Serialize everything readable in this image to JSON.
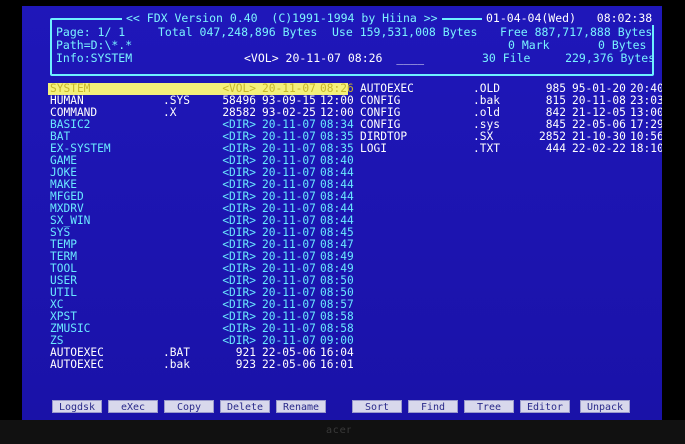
{
  "header": {
    "title": "<< FDX Version 0.40  (C)1991-1994 by Hiina >>",
    "datetime": "01-04-04(Wed)   08:02:38",
    "line1_left": "Page: 1/ 1",
    "line1_total": "Total 047,248,896 Bytes",
    "line1_use": "Use 159,531,008 Bytes",
    "line1_free": "Free 887,717,888 Bytes",
    "line2_left": "Path=D:\\*.*",
    "line2_mark": "0 Mark       0 Bytes",
    "line3_left": "Info:SYSTEM",
    "line3_vol": "<VOL> 20-11-07 08:26  ____",
    "line3_file": "30 File     229,376 Bytes"
  },
  "left_files": [
    {
      "name": "SYSTEM",
      "ext": "",
      "size": "<VOL>",
      "date": "20-11-07",
      "time": "08:26",
      "type": "sel"
    },
    {
      "name": "HUMAN",
      "ext": ".SYS",
      "size": "58496",
      "date": "93-09-15",
      "time": "12:00",
      "type": "file"
    },
    {
      "name": "COMMAND",
      "ext": ".X",
      "size": "28582",
      "date": "93-02-25",
      "time": "12:00",
      "type": "file"
    },
    {
      "name": "BASIC2",
      "ext": "",
      "size": "<DIR>",
      "date": "20-11-07",
      "time": "08:34",
      "type": "dir"
    },
    {
      "name": "BAT",
      "ext": "",
      "size": "<DIR>",
      "date": "20-11-07",
      "time": "08:35",
      "type": "dir"
    },
    {
      "name": "EX-SYSTEM",
      "ext": "",
      "size": "<DIR>",
      "date": "20-11-07",
      "time": "08:35",
      "type": "dir"
    },
    {
      "name": "GAME",
      "ext": "",
      "size": "<DIR>",
      "date": "20-11-07",
      "time": "08:40",
      "type": "dir"
    },
    {
      "name": "JOKE",
      "ext": "",
      "size": "<DIR>",
      "date": "20-11-07",
      "time": "08:44",
      "type": "dir"
    },
    {
      "name": "MAKE",
      "ext": "",
      "size": "<DIR>",
      "date": "20-11-07",
      "time": "08:44",
      "type": "dir"
    },
    {
      "name": "MFGED",
      "ext": "",
      "size": "<DIR>",
      "date": "20-11-07",
      "time": "08:44",
      "type": "dir"
    },
    {
      "name": "MXDRV",
      "ext": "",
      "size": "<DIR>",
      "date": "20-11-07",
      "time": "08:44",
      "type": "dir"
    },
    {
      "name": "SX_WIN",
      "ext": "",
      "size": "<DIR>",
      "date": "20-11-07",
      "time": "08:44",
      "type": "dir"
    },
    {
      "name": "SYS",
      "ext": "",
      "size": "<DIR>",
      "date": "20-11-07",
      "time": "08:45",
      "type": "dir"
    },
    {
      "name": "TEMP",
      "ext": "",
      "size": "<DIR>",
      "date": "20-11-07",
      "time": "08:47",
      "type": "dir"
    },
    {
      "name": "TERM",
      "ext": "",
      "size": "<DIR>",
      "date": "20-11-07",
      "time": "08:49",
      "type": "dir"
    },
    {
      "name": "TOOL",
      "ext": "",
      "size": "<DIR>",
      "date": "20-11-07",
      "time": "08:49",
      "type": "dir"
    },
    {
      "name": "USER",
      "ext": "",
      "size": "<DIR>",
      "date": "20-11-07",
      "time": "08:50",
      "type": "dir"
    },
    {
      "name": "UTIL",
      "ext": "",
      "size": "<DIR>",
      "date": "20-11-07",
      "time": "08:50",
      "type": "dir"
    },
    {
      "name": "XC",
      "ext": "",
      "size": "<DIR>",
      "date": "20-11-07",
      "time": "08:57",
      "type": "dir"
    },
    {
      "name": "XPST",
      "ext": "",
      "size": "<DIR>",
      "date": "20-11-07",
      "time": "08:58",
      "type": "dir"
    },
    {
      "name": "ZMUSIC",
      "ext": "",
      "size": "<DIR>",
      "date": "20-11-07",
      "time": "08:58",
      "type": "dir"
    },
    {
      "name": "ZS",
      "ext": "",
      "size": "<DIR>",
      "date": "20-11-07",
      "time": "09:00",
      "type": "dir"
    },
    {
      "name": "AUTOEXEC",
      "ext": ".BAT",
      "size": "921",
      "date": "22-05-06",
      "time": "16:04",
      "type": "file"
    },
    {
      "name": "AUTOEXEC",
      "ext": ".bak",
      "size": "923",
      "date": "22-05-06",
      "time": "16:01",
      "type": "file"
    }
  ],
  "right_files": [
    {
      "name": "AUTOEXEC",
      "ext": ".OLD",
      "size": "985",
      "date": "95-01-20",
      "time": "20:40",
      "type": "file"
    },
    {
      "name": "CONFIG",
      "ext": ".bak",
      "size": "815",
      "date": "20-11-08",
      "time": "23:03",
      "type": "file"
    },
    {
      "name": "CONFIG",
      "ext": ".old",
      "size": "842",
      "date": "21-12-05",
      "time": "13:00",
      "type": "file"
    },
    {
      "name": "CONFIG",
      "ext": ".sys",
      "size": "845",
      "date": "22-05-06",
      "time": "17:29",
      "type": "file"
    },
    {
      "name": "DIRDTOP",
      "ext": ".SX",
      "size": "2852",
      "date": "21-10-30",
      "time": "10:56",
      "type": "file"
    },
    {
      "name": "LOGI",
      "ext": ".TXT",
      "size": "444",
      "date": "22-02-22",
      "time": "18:10",
      "type": "file"
    }
  ],
  "fkeys": [
    "Logdsk",
    "eXec",
    "Copy",
    "Delete",
    "Rename",
    "Sort",
    "Find",
    "Tree",
    "Editor",
    "Unpack"
  ],
  "brand": "acer"
}
